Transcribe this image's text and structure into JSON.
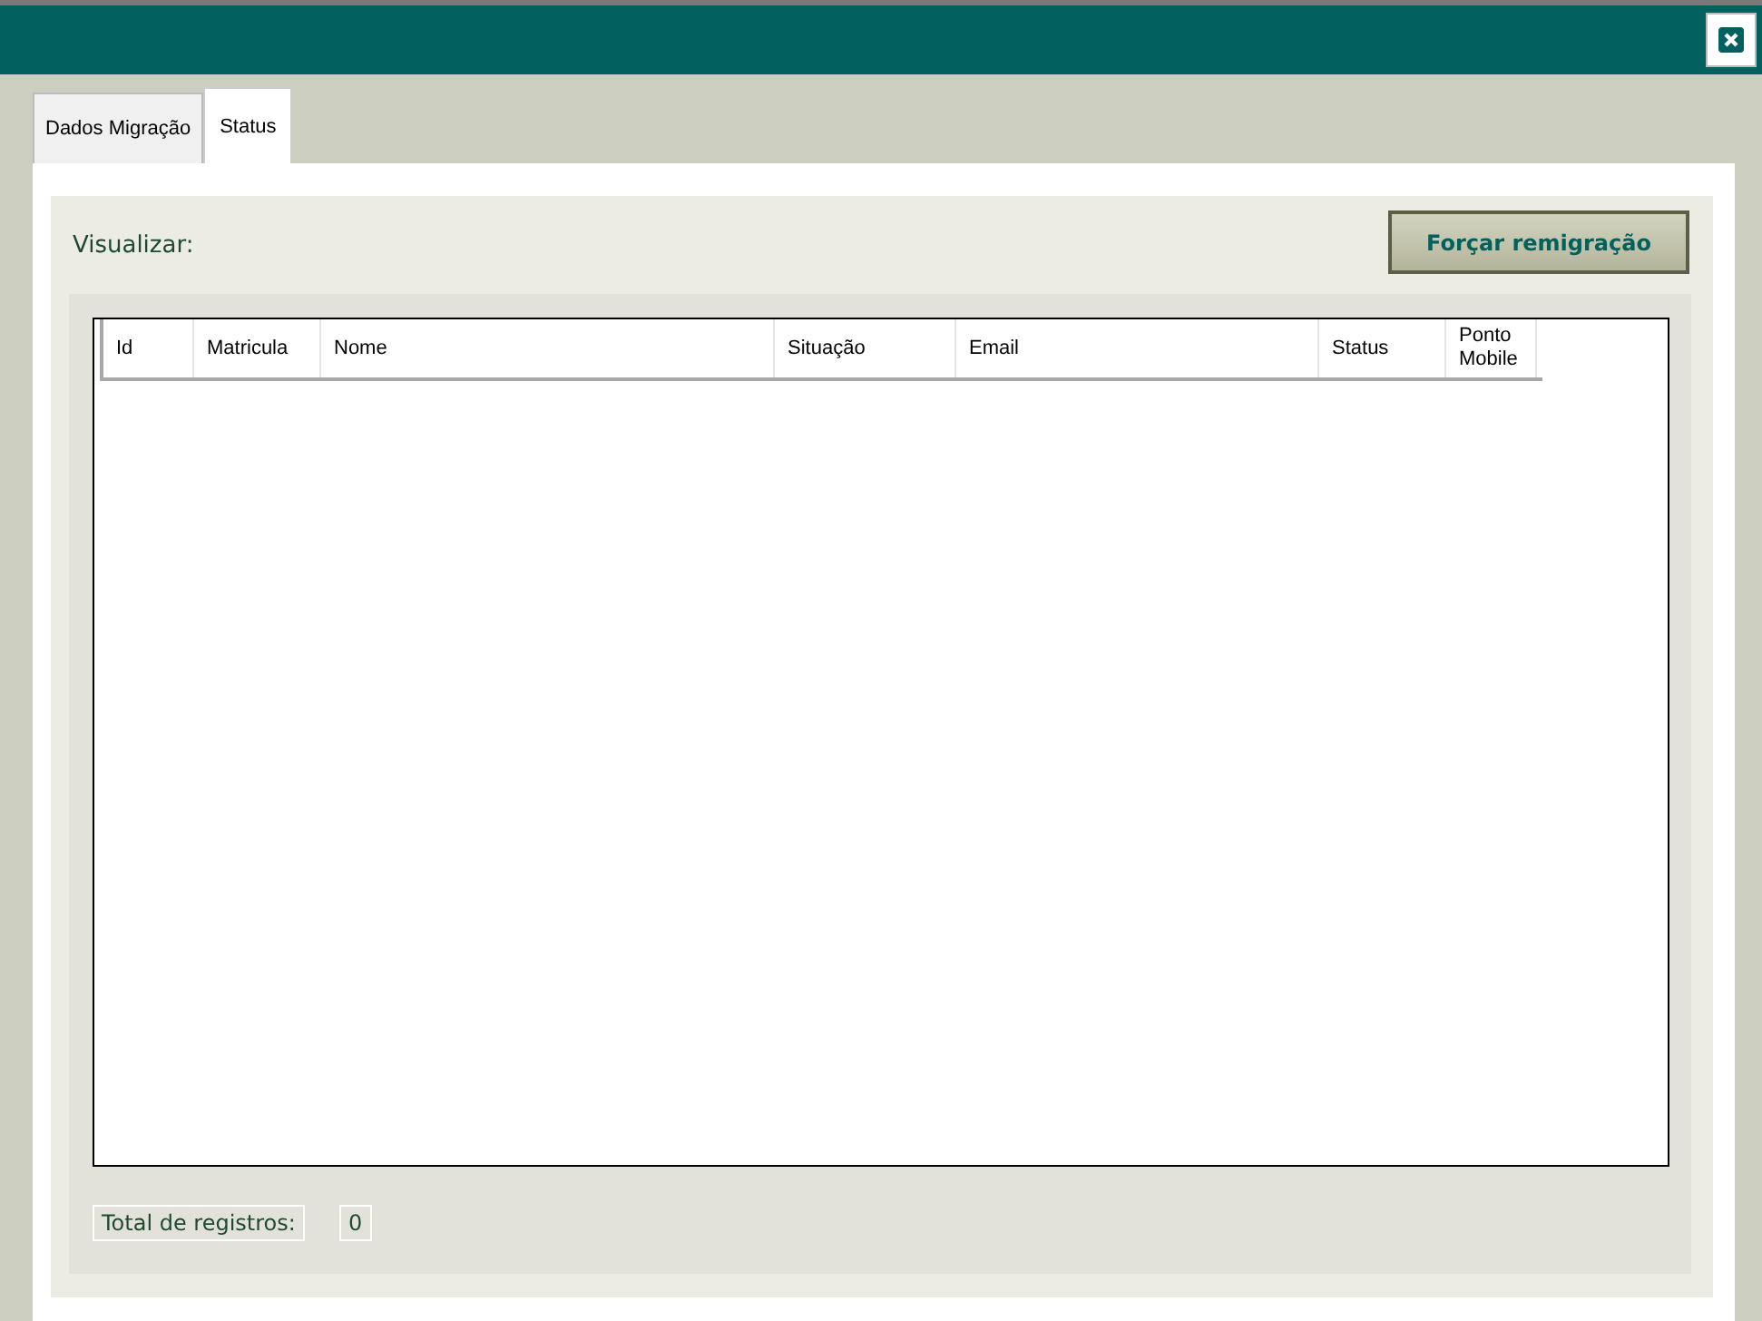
{
  "tabs": [
    {
      "label": "Dados Migração",
      "selected": false
    },
    {
      "label": "Status",
      "selected": true
    }
  ],
  "view_label": "Visualizar:",
  "action_button": "Forçar remigração",
  "table": {
    "columns": [
      "Id",
      "Matricula",
      "Nome",
      "Situação",
      "Email",
      "Status",
      "Ponto Mobile"
    ]
  },
  "total": {
    "label": "Total de registros:",
    "value": "0"
  }
}
